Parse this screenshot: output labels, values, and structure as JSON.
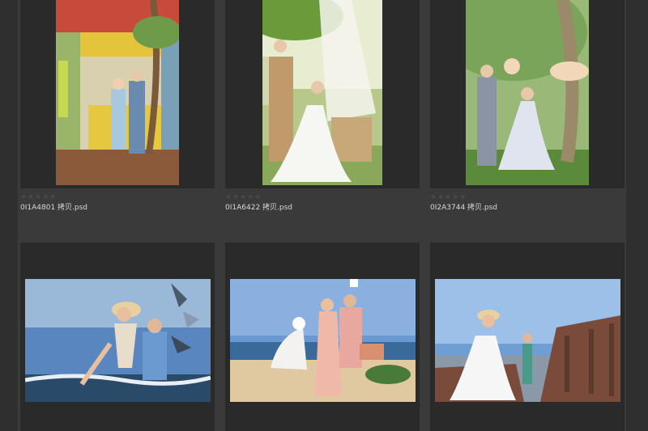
{
  "colors": {
    "background": "#3a3a3a",
    "cell": "#2a2a2a",
    "strip": "#2f2f2f",
    "star_empty": "#4a4a4a",
    "filename_text": "#d8d8d8"
  },
  "gallery": {
    "items": [
      {
        "filename": "0I1A4801 拷贝.psd",
        "rating": 0,
        "rating_stars": "★★★★★"
      },
      {
        "filename": "0I1A6422 拷贝.psd",
        "rating": 0,
        "rating_stars": "★★★★★"
      },
      {
        "filename": "0I2A3744 拷贝.psd",
        "rating": 0,
        "rating_stars": "★★★★★"
      },
      {
        "filename": "",
        "rating": 0,
        "rating_stars": ""
      },
      {
        "filename": "",
        "rating": 0,
        "rating_stars": ""
      },
      {
        "filename": "",
        "rating": 0,
        "rating_stars": ""
      }
    ]
  }
}
